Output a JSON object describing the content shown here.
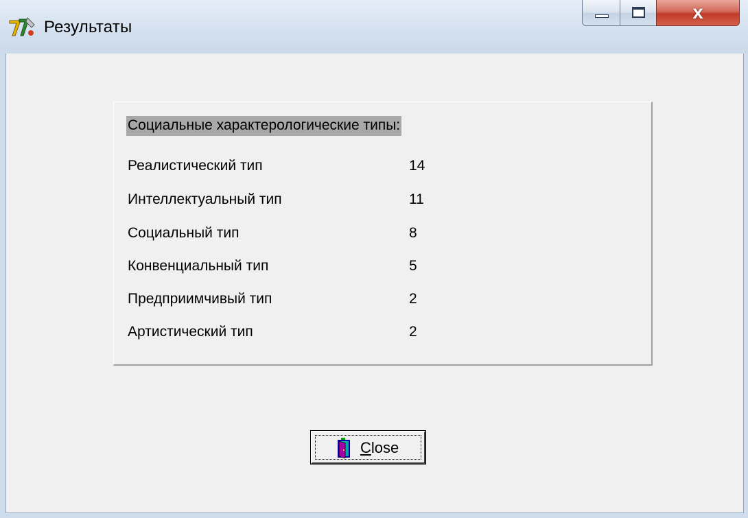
{
  "window": {
    "title": "Результаты",
    "icon": "delphi-app-icon",
    "controls": {
      "minimize": "minimize-icon",
      "maximize": "maximize-icon",
      "close": "x"
    }
  },
  "results": {
    "heading": "Социальные характерологические типы:",
    "rows": [
      {
        "label": "Реалистический тип",
        "value": "14"
      },
      {
        "label": "Интеллектуальный тип",
        "value": "11"
      },
      {
        "label": "Социальный тип",
        "value": "8"
      },
      {
        "label": "Конвенциальный тип",
        "value": "5"
      },
      {
        "label": "Предприимчивый тип",
        "value": "2"
      },
      {
        "label": "Артистический тип",
        "value": "2"
      }
    ]
  },
  "close_button": {
    "mnemonic": "C",
    "rest": "lose",
    "icon": "door-icon"
  },
  "colors": {
    "client_bg": "#f0f0f0",
    "heading_highlight": "#a8a8a8",
    "close_button_red": "#c23b2a"
  }
}
